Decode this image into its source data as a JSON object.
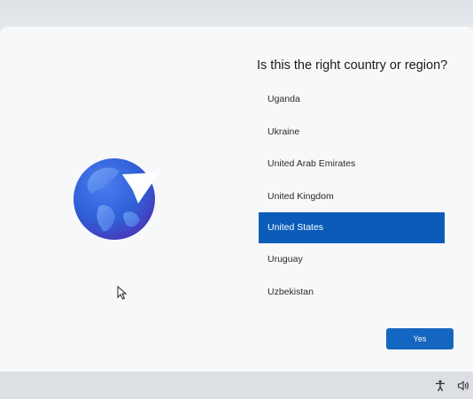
{
  "screen": {
    "title": "Is this the right country or region?",
    "countries": [
      "Uganda",
      "Ukraine",
      "United Arab Emirates",
      "United Kingdom",
      "United States",
      "Uruguay",
      "Uzbekistan"
    ],
    "selected_country": "United States",
    "yes_label": "Yes"
  },
  "icons": {
    "illustration": "globe-with-paper-plane-icon",
    "accessibility": "accessibility-icon",
    "volume": "volume-icon",
    "cursor": "mouse-cursor-icon"
  },
  "colors": {
    "selection": "#0a5cb8",
    "button": "#1566c0",
    "background": "#f7f8fa"
  }
}
